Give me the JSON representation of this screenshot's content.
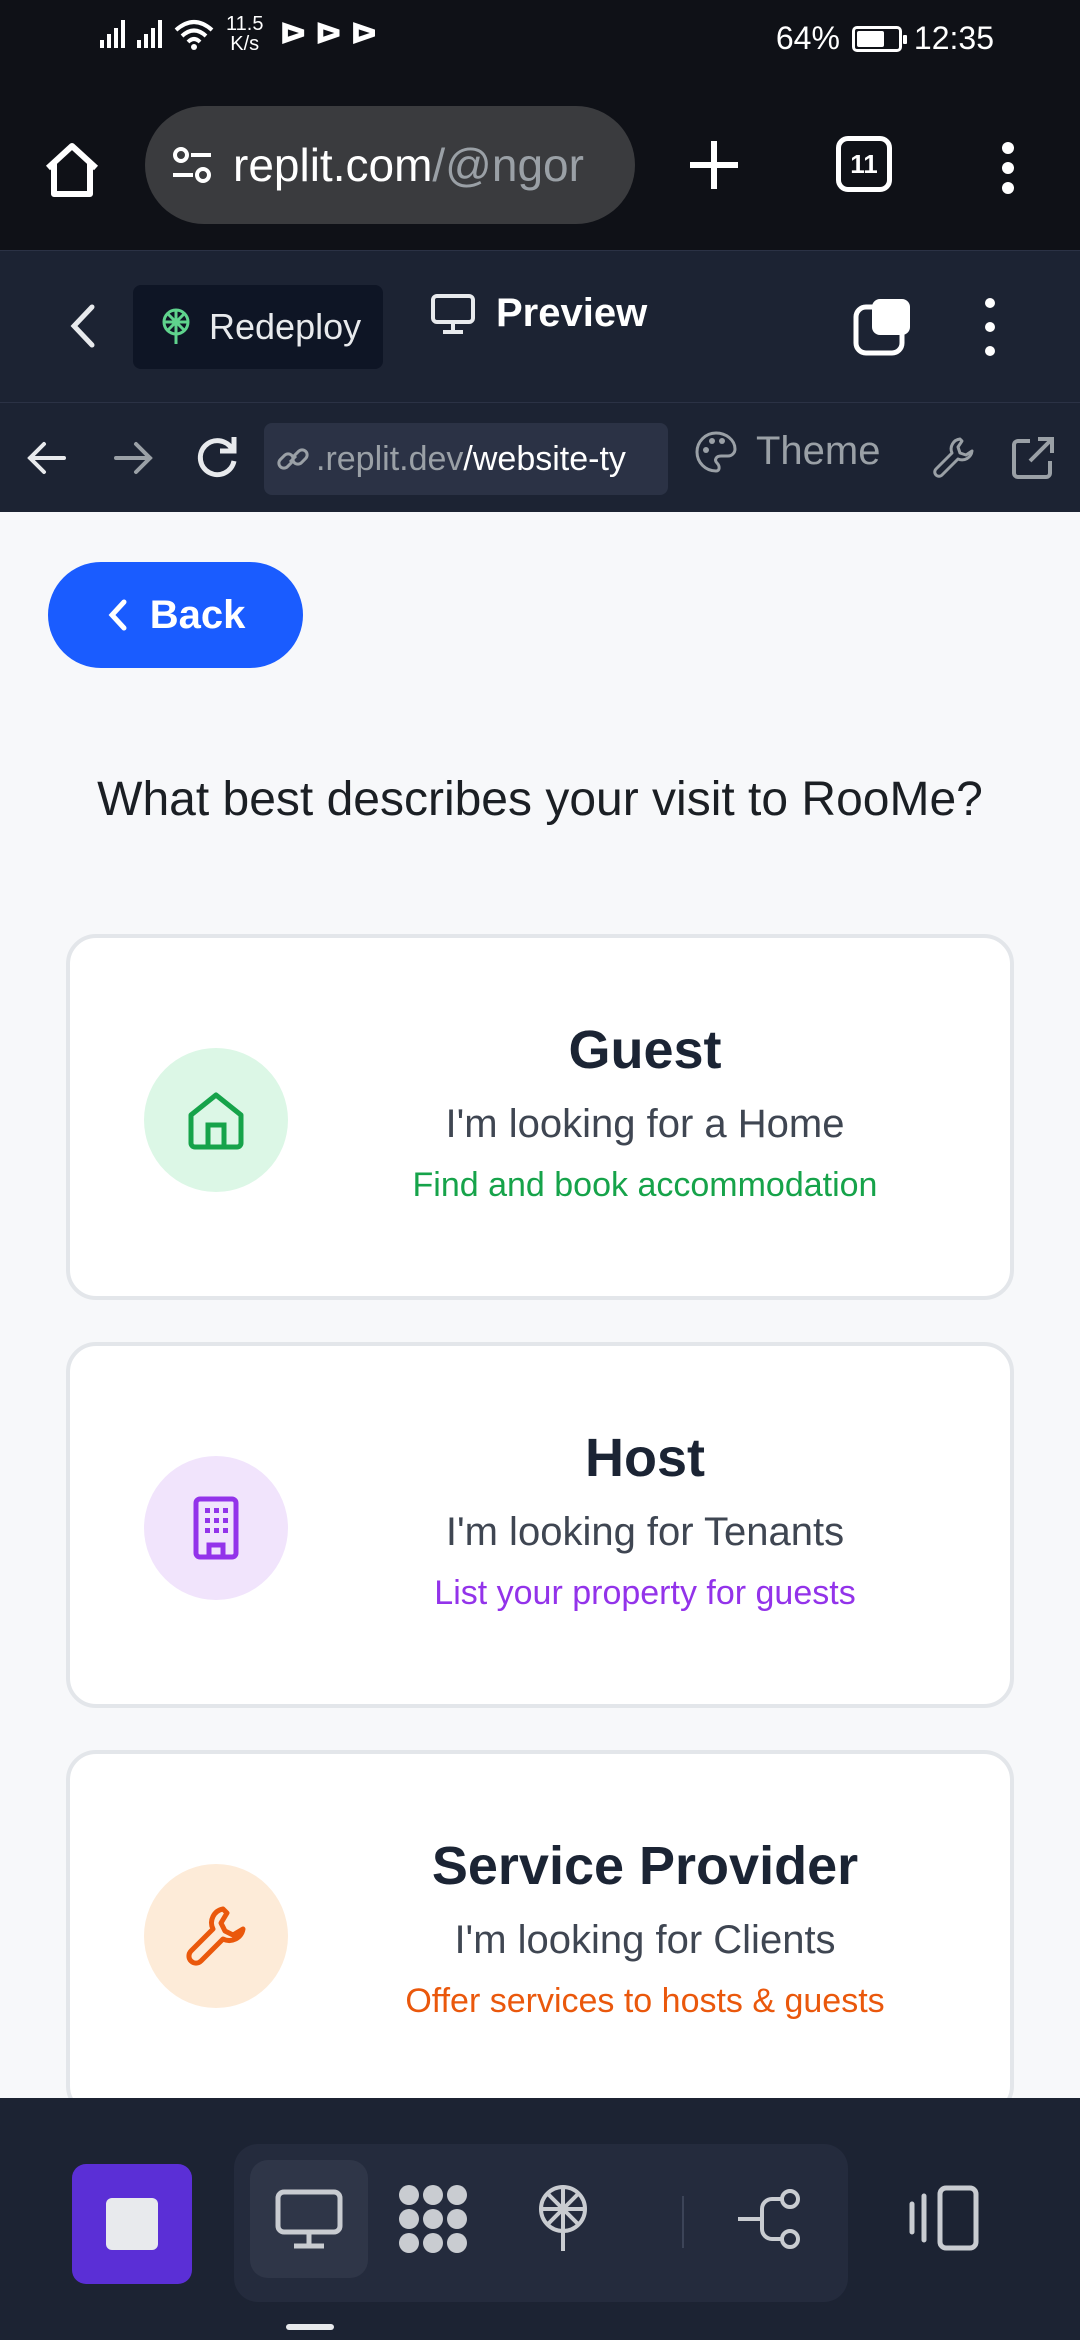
{
  "status_bar": {
    "speed_value": "11.5",
    "speed_unit": "K/s",
    "notif_glyphs": "ᐅ ᐅ ᐅ",
    "battery": "64%",
    "time": "12:35"
  },
  "browser": {
    "url_host": "replit.com",
    "url_path": "/@ngor",
    "tab_count": "11"
  },
  "replit": {
    "redeploy_label": "Redeploy",
    "preview_label": "Preview"
  },
  "preview_nav": {
    "address_dim": ".replit.dev",
    "address_path": "/website-ty",
    "theme_label": "Theme"
  },
  "page": {
    "back_label": "Back",
    "question": "What best describes your visit to RooMe?",
    "options": [
      {
        "title": "Guest",
        "subtitle": "I'm looking for a Home",
        "description": "Find and book accommodation",
        "accent": "#16a34a",
        "icon_bg": "#dcf7e6",
        "icon": "home-icon"
      },
      {
        "title": "Host",
        "subtitle": "I'm looking for Tenants",
        "description": "List your property for guests",
        "accent": "#9333ea",
        "icon_bg": "#f1e4fc",
        "icon": "building-icon"
      },
      {
        "title": "Service Provider",
        "subtitle": "I'm looking for Clients",
        "description": "Offer services to hosts & guests",
        "accent": "#ea580c",
        "icon_bg": "#fdebd8",
        "icon": "wrench-icon"
      }
    ]
  }
}
